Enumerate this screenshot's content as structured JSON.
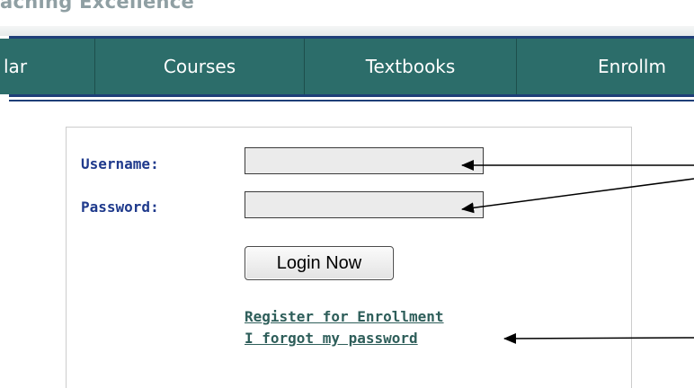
{
  "header": {
    "tagline": "aching Excellence"
  },
  "nav": {
    "items": [
      "lar",
      "Courses",
      "Textbooks",
      "Enrollm"
    ]
  },
  "login": {
    "username_label": "Username:",
    "password_label": "Password:",
    "username_value": "",
    "password_value": "",
    "submit_label": "Login Now",
    "register_link": "Register for Enrollment",
    "forgot_link": "I forgot my password"
  },
  "colors": {
    "nav_background": "#2c6d6a",
    "nav_rule": "#1f3f78",
    "label_text": "#1f3a8c",
    "link_text": "#2e5e5a",
    "input_background": "#ebebeb"
  },
  "annotations": {
    "arrow_count": 3
  }
}
